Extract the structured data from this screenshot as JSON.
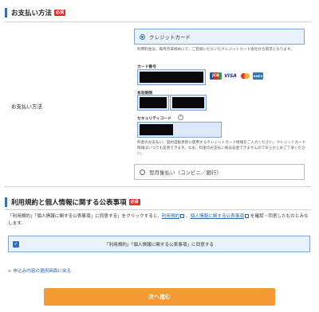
{
  "payment_section": {
    "title": "お支払い方法",
    "required_badge": "必須",
    "row_label": "お支払い方法",
    "option_credit": "クレジットカード",
    "credit_note": "利用料金は、毎月月末締めにて、ご登録いただいたクレジットカード会社から請求となります。",
    "card_number_label": "カード番号",
    "expiry_label": "有効期限",
    "security_code_label": "セキュリティコード",
    "help_icon_text": "?",
    "fee_note": "料金のお支払い、契約自動更新に使用するクレジットカード情報をご入力ください。クレジットカード情報はいつでも変更できます。なお、料金のお支払い後は返金できませんのであらかじめご了承ください。",
    "option_postpay": "翌月後払い（コンビニ／銀行）",
    "card_brands": [
      "JCB",
      "VISA",
      "mastercard",
      "AMEX"
    ]
  },
  "terms_section": {
    "title": "利用規約と個人情報に関する公表事項",
    "required_badge": "必須",
    "text_before": "「利用規約」「個人情報に関する公表事項」に同意する」をクリックすると、",
    "link_terms": "利用規約",
    "link_sep": "、",
    "link_privacy": "個人情報に関する公表事項",
    "text_after": "を確認・同意したものとみなします。",
    "agree_label": "「利用規約」「個人情報に関する公表事項」に同意する",
    "agree_checked": true
  },
  "back_link": "← 申込み内容の選択画面に戻る",
  "next_button": "次へ進む",
  "colors": {
    "accent_blue": "#2f6fc4",
    "required_red": "#d9302c",
    "button_orange": "#f39a34",
    "link_blue": "#2a63b8"
  }
}
